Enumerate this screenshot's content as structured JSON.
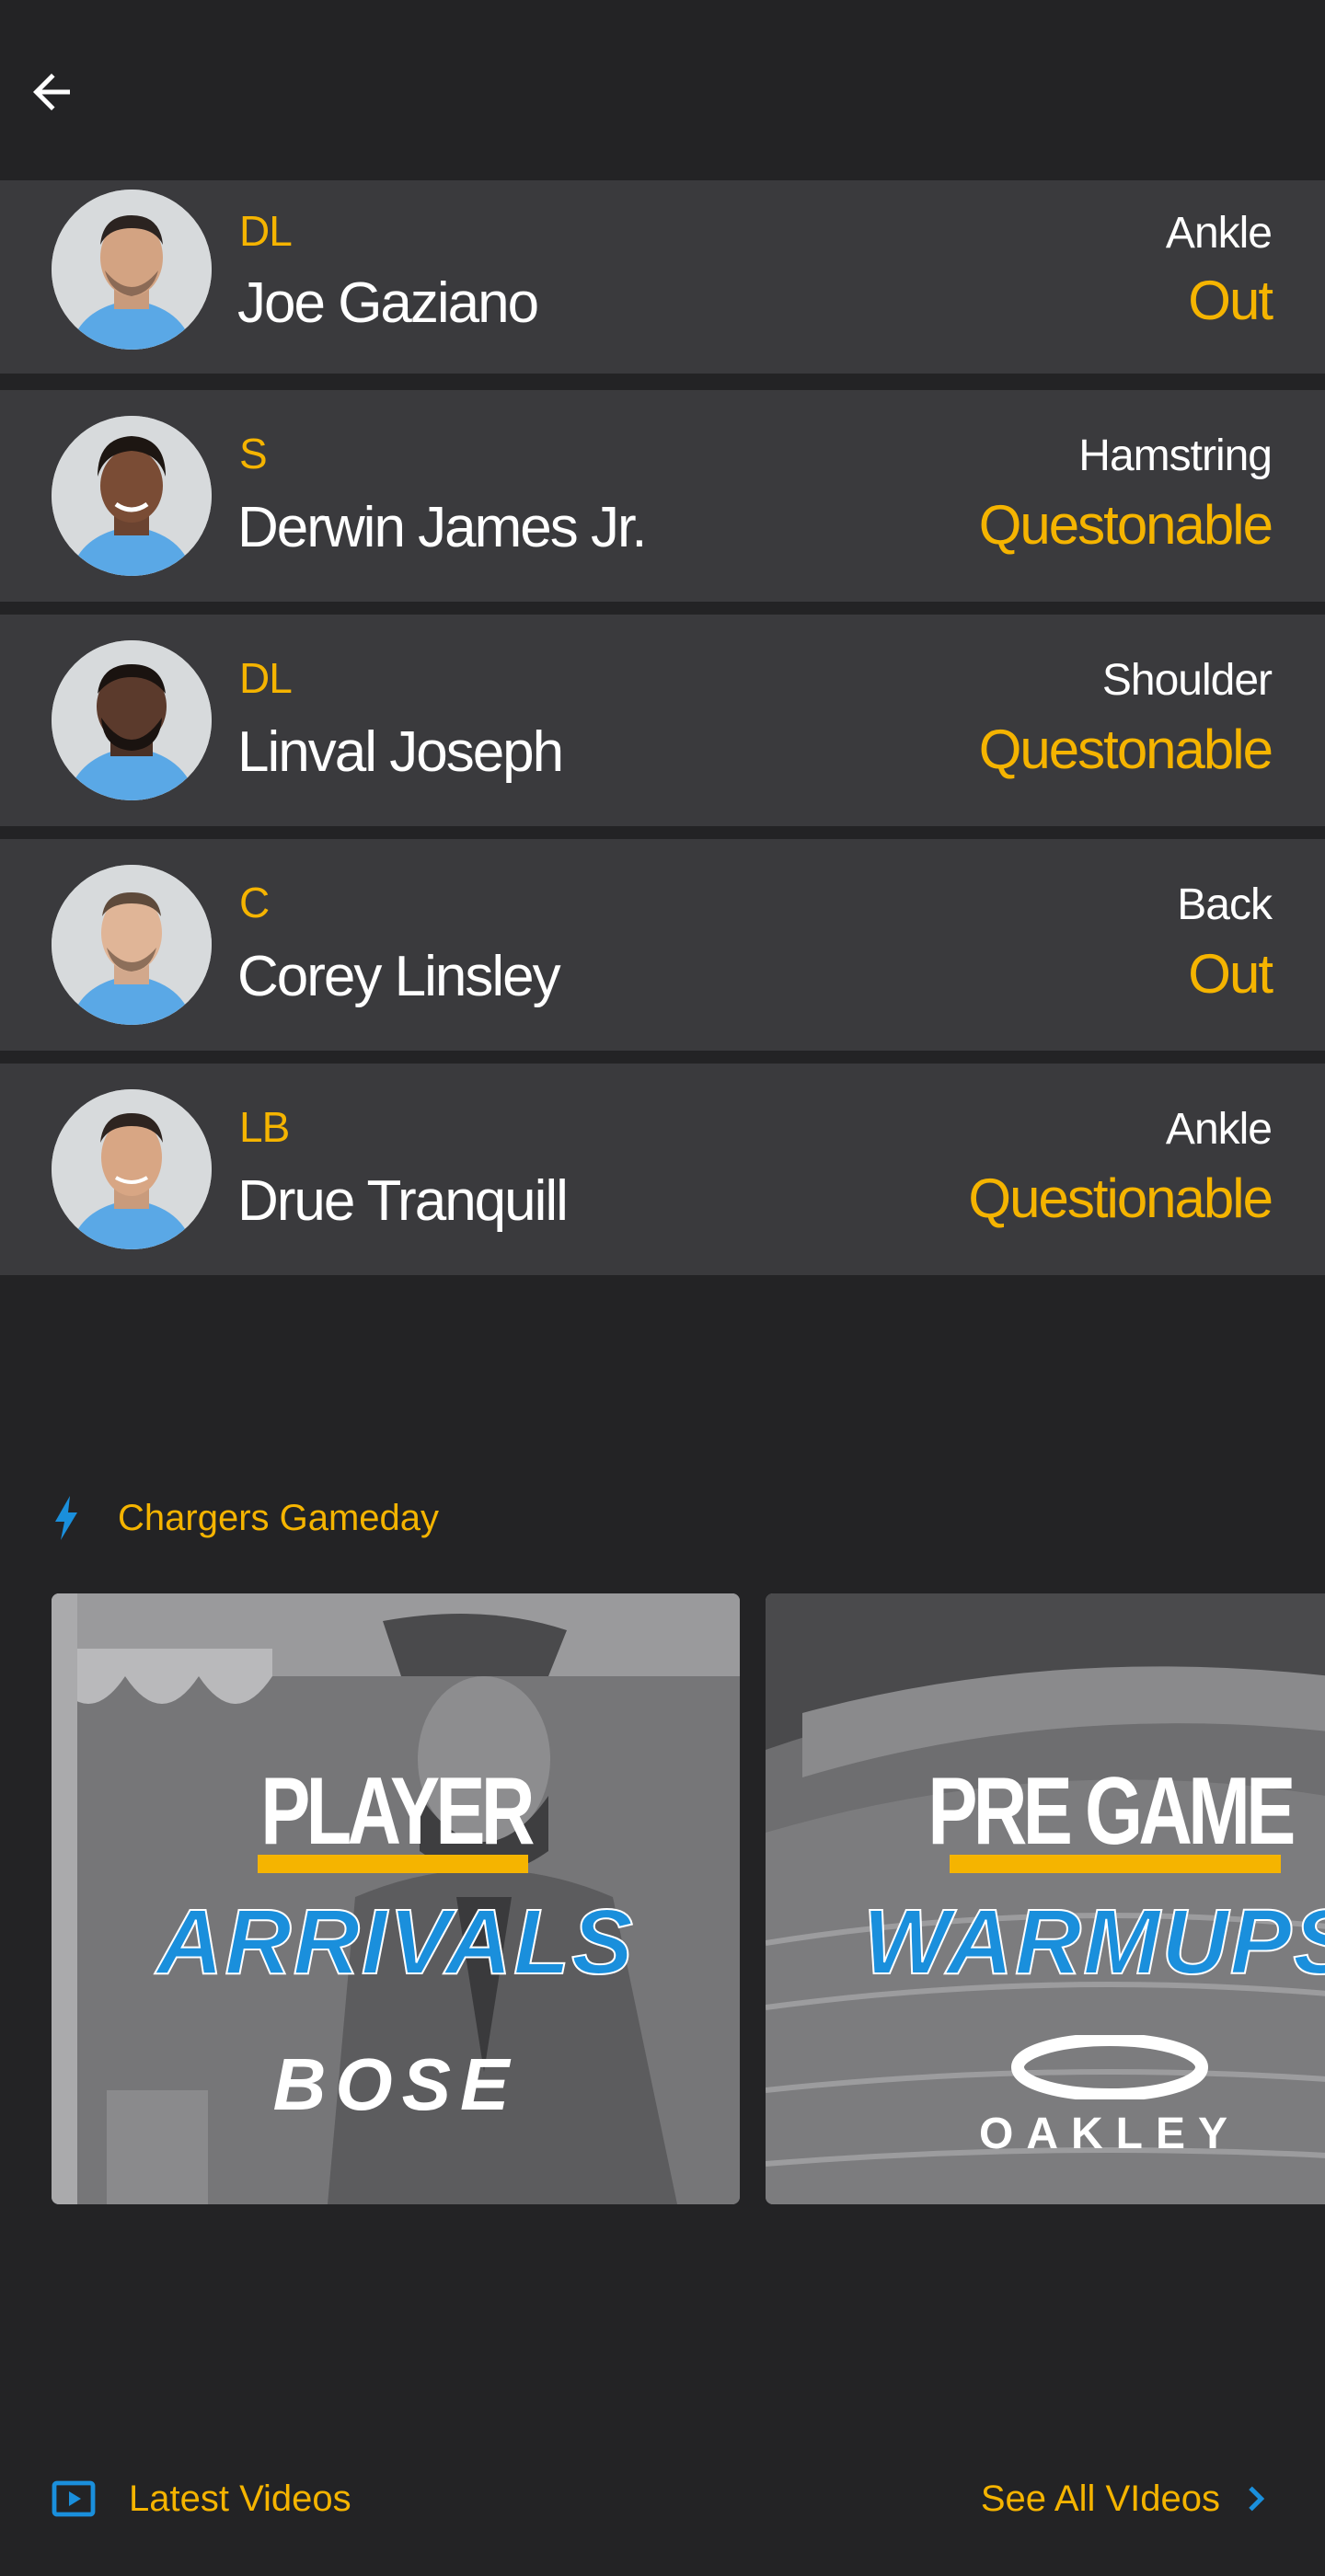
{
  "header": {
    "back_icon": "arrow-left-icon"
  },
  "injuries": [
    {
      "position": "DL",
      "name": "Joe Gaziano",
      "injury": "Ankle",
      "status": "Out"
    },
    {
      "position": "S",
      "name": "Derwin James Jr.",
      "injury": "Hamstring",
      "status": "Questonable"
    },
    {
      "position": "DL",
      "name": "Linval Joseph",
      "injury": "Shoulder",
      "status": "Questonable"
    },
    {
      "position": "C",
      "name": "Corey Linsley",
      "injury": "Back",
      "status": "Out"
    },
    {
      "position": "LB",
      "name": "Drue Tranquill",
      "injury": "Ankle",
      "status": "Questionable"
    }
  ],
  "gameday": {
    "icon": "lightning-bolt-icon",
    "title": "Chargers Gameday",
    "cards": [
      {
        "line1": "PLAYER",
        "line2": "ARRIVALS",
        "sponsor": "BOSE"
      },
      {
        "line1": "PRE GAME",
        "line2": "WARMUPS",
        "sponsor": "OAKLEY"
      }
    ]
  },
  "videos": {
    "icon": "play-box-icon",
    "title": "Latest Videos",
    "see_all": "See All VIdeos",
    "see_all_icon": "chevron-right-icon"
  },
  "colors": {
    "background": "#232325",
    "row": "#3a3a3d",
    "accent": "#f5b400",
    "brand_blue": "#1a8fdc"
  }
}
